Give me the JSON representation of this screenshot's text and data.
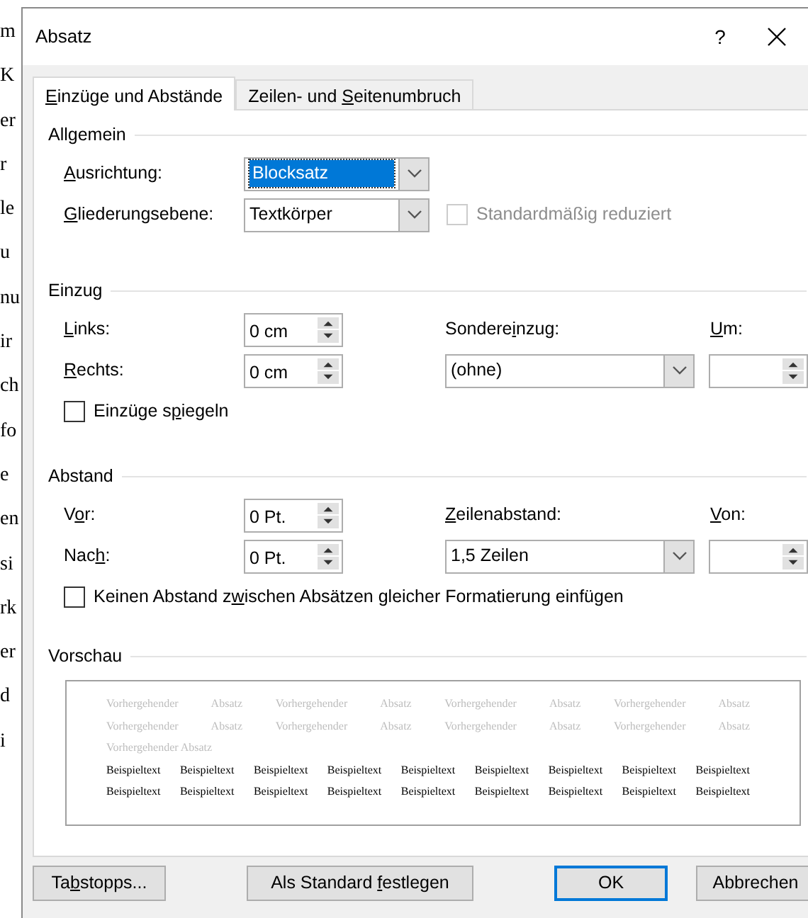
{
  "background_document": {
    "line_fragments": [
      "m",
      "K",
      "er",
      "r",
      "le",
      "u",
      "nu",
      "ir",
      "ch",
      "fo",
      "e",
      "en",
      "si",
      "rk",
      "er",
      "d",
      "i"
    ]
  },
  "window": {
    "title": "Absatz",
    "help": "?"
  },
  "tabs": [
    {
      "label": {
        "key": "E",
        "after": "inzüge und Abstände"
      },
      "selected": true
    },
    {
      "label": {
        "before": "Zeilen- und ",
        "key": "S",
        "after": "eitenumbruch"
      },
      "selected": false
    }
  ],
  "general": {
    "title": "Allgemein",
    "alignment": {
      "label": {
        "key": "A",
        "after": "usrichtung:"
      },
      "value": "Blocksatz",
      "highlighted": true
    },
    "outline_level": {
      "label": {
        "key": "G",
        "after": "liederungsebene:"
      },
      "value": "Textkörper",
      "highlighted": false
    },
    "collapsed_by_default": {
      "label": {
        "before": "Standardmäßig reduziert"
      },
      "checked": false,
      "disabled": true
    }
  },
  "indentation": {
    "title": "Einzug",
    "left": {
      "label": {
        "key": "L",
        "after": "inks:"
      },
      "value": "0 cm"
    },
    "right": {
      "label": {
        "key": "R",
        "after": "echts:"
      },
      "value": "0 cm"
    },
    "special": {
      "label": {
        "before": "Sondere",
        "key": "i",
        "after": "nzug:"
      },
      "value": "(ohne)",
      "highlighted": false
    },
    "by": {
      "label": {
        "key": "U",
        "after": "m:"
      }
    },
    "mirror": {
      "label": {
        "before": "Einzüge s",
        "key": "p",
        "after": "iegeln"
      },
      "checked": false,
      "disabled": false
    }
  },
  "spacing": {
    "title": "Abstand",
    "before": {
      "label": {
        "before": "V",
        "key": "o",
        "after": "r:"
      },
      "value": "0 Pt."
    },
    "after": {
      "label": {
        "before": "Nac",
        "key": "h",
        "after": ":"
      },
      "value": "0 Pt."
    },
    "line_spacing": {
      "label": {
        "key": "Z",
        "after": "eilenabstand:"
      },
      "value": "1,5 Zeilen",
      "highlighted": false
    },
    "at": {
      "label": {
        "key": "V",
        "after": "on:"
      }
    },
    "no_space": {
      "label": {
        "before": "Keinen Abstand z",
        "key": "w",
        "after": "ischen Absätzen gleicher Formatierung einfügen"
      },
      "checked": false,
      "disabled": false
    }
  },
  "preview": {
    "title": "Vorschau",
    "previous_lines": [
      "Vorhergehender Absatz Vorhergehender Absatz Vorhergehender Absatz Vorhergehender Absatz",
      "Vorhergehender Absatz Vorhergehender Absatz Vorhergehender Absatz Vorhergehender Absatz",
      "Vorhergehender Absatz"
    ],
    "sample_lines": [
      "Beispieltext Beispieltext Beispieltext Beispieltext Beispieltext Beispieltext Beispieltext Beispieltext Beispieltext",
      "Beispieltext Beispieltext Beispieltext Beispieltext Beispieltext Beispieltext Beispieltext Beispieltext Beispieltext"
    ]
  },
  "buttons": [
    {
      "label": {
        "before": "Ta",
        "key": "b",
        "after": "stopps..."
      },
      "default": false
    },
    {
      "label": {
        "before": "Als Standard ",
        "key": "f",
        "after": "estlegen"
      },
      "default": false
    },
    {
      "label": {
        "before": "OK"
      },
      "default": true
    },
    {
      "label": {
        "before": "Abbrechen"
      },
      "default": false
    }
  ]
}
